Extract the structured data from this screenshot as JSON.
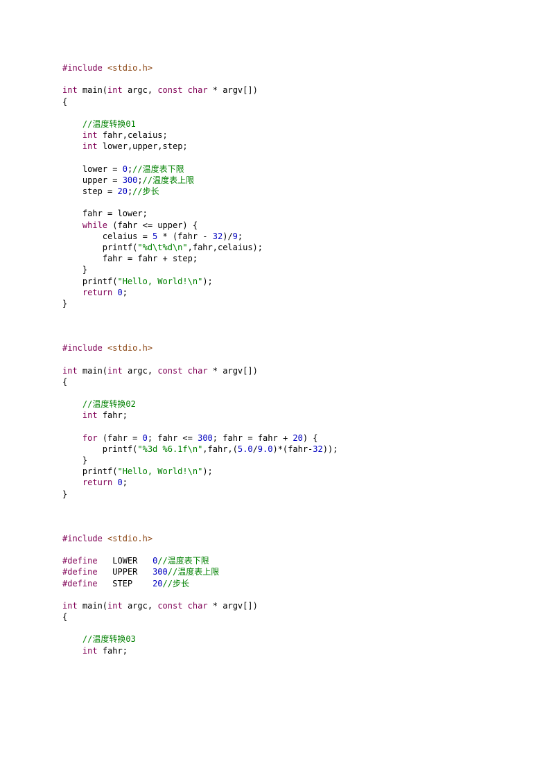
{
  "blocks": [
    {
      "tokens": [
        [
          [
            "pp",
            "#include"
          ],
          [
            "op",
            " "
          ],
          [
            "inc",
            "<stdio.h>"
          ]
        ],
        [
          [
            "op",
            ""
          ]
        ],
        [
          [
            "kw",
            "int"
          ],
          [
            "op",
            " main("
          ],
          [
            "kw",
            "int"
          ],
          [
            "op",
            " argc, "
          ],
          [
            "kw",
            "const"
          ],
          [
            "op",
            " "
          ],
          [
            "kw",
            "char"
          ],
          [
            "op",
            " * argv[])"
          ]
        ],
        [
          [
            "op",
            "{"
          ]
        ],
        [
          [
            "op",
            ""
          ]
        ],
        [
          [
            "op",
            "    "
          ],
          [
            "cm",
            "//温度转换01"
          ]
        ],
        [
          [
            "op",
            "    "
          ],
          [
            "kw",
            "int"
          ],
          [
            "op",
            " fahr,celaius;"
          ]
        ],
        [
          [
            "op",
            "    "
          ],
          [
            "kw",
            "int"
          ],
          [
            "op",
            " lower,upper,step;"
          ]
        ],
        [
          [
            "op",
            ""
          ]
        ],
        [
          [
            "op",
            "    lower = "
          ],
          [
            "num",
            "0"
          ],
          [
            "op",
            ";"
          ],
          [
            "cm",
            "//温度表下限"
          ]
        ],
        [
          [
            "op",
            "    upper = "
          ],
          [
            "num",
            "300"
          ],
          [
            "op",
            ";"
          ],
          [
            "cm",
            "//温度表上限"
          ]
        ],
        [
          [
            "op",
            "    step = "
          ],
          [
            "num",
            "20"
          ],
          [
            "op",
            ";"
          ],
          [
            "cm",
            "//步长"
          ]
        ],
        [
          [
            "op",
            ""
          ]
        ],
        [
          [
            "op",
            "    fahr = lower;"
          ]
        ],
        [
          [
            "op",
            "    "
          ],
          [
            "kw",
            "while"
          ],
          [
            "op",
            " (fahr <= upper) {"
          ]
        ],
        [
          [
            "op",
            "        celaius = "
          ],
          [
            "num",
            "5"
          ],
          [
            "op",
            " * (fahr - "
          ],
          [
            "num",
            "32"
          ],
          [
            "op",
            ")/"
          ],
          [
            "num",
            "9"
          ],
          [
            "op",
            ";"
          ]
        ],
        [
          [
            "op",
            "        printf("
          ],
          [
            "strg",
            "\"%d\\t%d\\n\""
          ],
          [
            "op",
            ",fahr,celaius);"
          ]
        ],
        [
          [
            "op",
            "        fahr = fahr + step;"
          ]
        ],
        [
          [
            "op",
            "    }"
          ]
        ],
        [
          [
            "op",
            "    printf("
          ],
          [
            "strg",
            "\"Hello, World!\\n\""
          ],
          [
            "op",
            ");"
          ]
        ],
        [
          [
            "op",
            "    "
          ],
          [
            "kw",
            "return"
          ],
          [
            "op",
            " "
          ],
          [
            "num",
            "0"
          ],
          [
            "op",
            ";"
          ]
        ],
        [
          [
            "op",
            "}"
          ]
        ]
      ]
    },
    {
      "tokens": [
        [
          [
            "pp",
            "#include"
          ],
          [
            "op",
            " "
          ],
          [
            "inc",
            "<stdio.h>"
          ]
        ],
        [
          [
            "op",
            ""
          ]
        ],
        [
          [
            "kw",
            "int"
          ],
          [
            "op",
            " main("
          ],
          [
            "kw",
            "int"
          ],
          [
            "op",
            " argc, "
          ],
          [
            "kw",
            "const"
          ],
          [
            "op",
            " "
          ],
          [
            "kw",
            "char"
          ],
          [
            "op",
            " * argv[])"
          ]
        ],
        [
          [
            "op",
            "{"
          ]
        ],
        [
          [
            "op",
            ""
          ]
        ],
        [
          [
            "op",
            "    "
          ],
          [
            "cm",
            "//温度转换02"
          ]
        ],
        [
          [
            "op",
            "    "
          ],
          [
            "kw",
            "int"
          ],
          [
            "op",
            " fahr;"
          ]
        ],
        [
          [
            "op",
            ""
          ]
        ],
        [
          [
            "op",
            "    "
          ],
          [
            "kw",
            "for"
          ],
          [
            "op",
            " (fahr = "
          ],
          [
            "num",
            "0"
          ],
          [
            "op",
            "; fahr <= "
          ],
          [
            "num",
            "300"
          ],
          [
            "op",
            "; fahr = fahr + "
          ],
          [
            "num",
            "20"
          ],
          [
            "op",
            ") {"
          ]
        ],
        [
          [
            "op",
            "        printf("
          ],
          [
            "strg",
            "\"%3d %6.1f\\n\""
          ],
          [
            "op",
            ",fahr,("
          ],
          [
            "num",
            "5.0"
          ],
          [
            "op",
            "/"
          ],
          [
            "num",
            "9.0"
          ],
          [
            "op",
            ")*(fahr-"
          ],
          [
            "num",
            "32"
          ],
          [
            "op",
            "));"
          ]
        ],
        [
          [
            "op",
            "    }"
          ]
        ],
        [
          [
            "op",
            "    printf("
          ],
          [
            "strg",
            "\"Hello, World!\\n\""
          ],
          [
            "op",
            ");"
          ]
        ],
        [
          [
            "op",
            "    "
          ],
          [
            "kw",
            "return"
          ],
          [
            "op",
            " "
          ],
          [
            "num",
            "0"
          ],
          [
            "op",
            ";"
          ]
        ],
        [
          [
            "op",
            "}"
          ]
        ]
      ]
    },
    {
      "tokens": [
        [
          [
            "pp",
            "#include"
          ],
          [
            "op",
            " "
          ],
          [
            "inc",
            "<stdio.h>"
          ]
        ],
        [
          [
            "op",
            ""
          ]
        ],
        [
          [
            "pp",
            "#define"
          ],
          [
            "op",
            "   LOWER   "
          ],
          [
            "num",
            "0"
          ],
          [
            "cm",
            "//温度表下限"
          ]
        ],
        [
          [
            "pp",
            "#define"
          ],
          [
            "op",
            "   UPPER   "
          ],
          [
            "num",
            "300"
          ],
          [
            "cm",
            "//温度表上限"
          ]
        ],
        [
          [
            "pp",
            "#define"
          ],
          [
            "op",
            "   STEP    "
          ],
          [
            "num",
            "20"
          ],
          [
            "cm",
            "//步长"
          ]
        ],
        [
          [
            "op",
            ""
          ]
        ],
        [
          [
            "kw",
            "int"
          ],
          [
            "op",
            " main("
          ],
          [
            "kw",
            "int"
          ],
          [
            "op",
            " argc, "
          ],
          [
            "kw",
            "const"
          ],
          [
            "op",
            " "
          ],
          [
            "kw",
            "char"
          ],
          [
            "op",
            " * argv[])"
          ]
        ],
        [
          [
            "op",
            "{"
          ]
        ],
        [
          [
            "op",
            ""
          ]
        ],
        [
          [
            "op",
            "    "
          ],
          [
            "cm",
            "//温度转换03"
          ]
        ],
        [
          [
            "op",
            "    "
          ],
          [
            "kw",
            "int"
          ],
          [
            "op",
            " fahr;"
          ]
        ]
      ]
    }
  ]
}
